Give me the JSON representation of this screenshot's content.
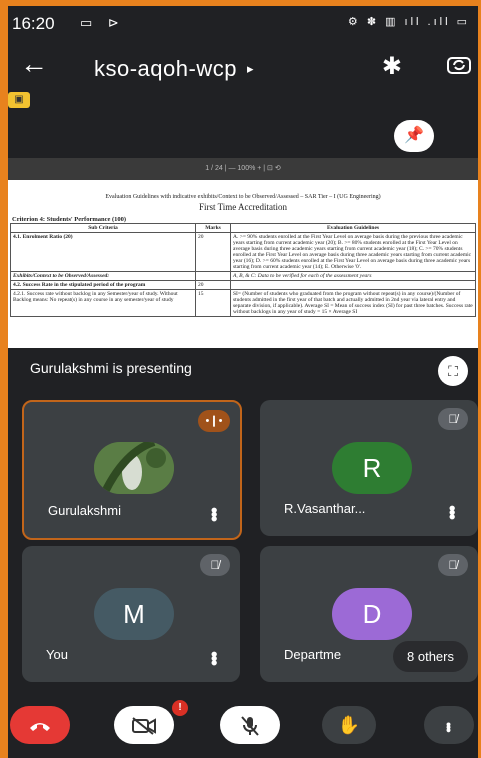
{
  "status_bar": {
    "time": "16:20",
    "left_icons": "▭ ⊳",
    "right_icons": "⚙ ✽ ▥ ıll .ıll ▭"
  },
  "top_bar": {
    "meeting_code": "kso-aqoh-wcp",
    "meeting_arrow": "▸",
    "bluetooth_icon": "bluetooth-icon",
    "camera_switch_icon": "camera-switch-icon"
  },
  "shared_document": {
    "toolbar": "1 / 24  |  —  100%  +  |  ⊡  ⟲",
    "caption_line1": "Evaluation Guidelines with indicative exhibits/Context to be Observed/Assessed – SAR Tier – I (UG Engineering)",
    "caption_line2": "First Time Accreditation",
    "criterion": "Criterion 4: Students' Performance (100)",
    "headers": [
      "Sub Criteria",
      "Marks",
      "Evaluation Guidelines"
    ],
    "rows": [
      [
        "4.1. Enrolment Ratio (20)",
        "20",
        "A. >= 90% students enrolled at the First Year Level on average basis during the previous three academic years starting from current academic year (20); B. >= 80% students enrolled at the First Year Level on average basis during three academic years starting from current academic year (18); C. >= 70% students enrolled at the First Year Level on average basis during three academic years starting from current academic year (16); D. >= 60% students enrolled at the First Year Level on average basis during three academic years starting from current academic year (14); E. Otherwise '0'."
      ],
      [
        "Exhibits/Context to be Observed/Assessed:",
        "",
        "A, B, & C: Data to be verified for each of the assessment years"
      ],
      [
        "4.2. Success Rate in the stipulated period of the program",
        "20",
        ""
      ],
      [
        "4.2.1. Success rate without backlog in any Semester/year of study. Without Backlog means: No repeat(s) in any course in any semester/year of study",
        "15",
        "SI= (Number of students who graduated from the program without repeat(s) in any course)/(Number of students admitted in the first year of that batch and actually admitted in 2nd year via lateral entry and separate division, if applicable). Average SI = Mean of success index (SI) for past three batches. Success rate without backlogs in any year of study = 15 × Average SI"
      ]
    ]
  },
  "presenting_text": "Gurulakshmi is presenting",
  "participants": [
    {
      "name": "Gurulakshmi",
      "avatar_kind": "photo",
      "speaking": true
    },
    {
      "name": "R.Vasanthar...",
      "initial": "R",
      "avatar_color": "#2e7d32",
      "muted": true
    },
    {
      "name": "You",
      "initial": "M",
      "avatar_color": "#455a64",
      "muted": true
    },
    {
      "name": "Departme",
      "initial": "D",
      "avatar_color": "#9c6ad6",
      "muted": true,
      "others_label": "8 others"
    }
  ],
  "controls": {
    "notification_badge": "!",
    "end_call_icon": "end-call-icon",
    "camera_off_icon": "camera-off-icon",
    "mic_off_icon": "mic-off-icon",
    "raise_hand_icon": "raise-hand-icon",
    "more_icon": "more-vertical-icon"
  },
  "colors": {
    "end_call": "#e53935",
    "accent_border": "#e8821e",
    "tile_bg": "#3c4043"
  }
}
